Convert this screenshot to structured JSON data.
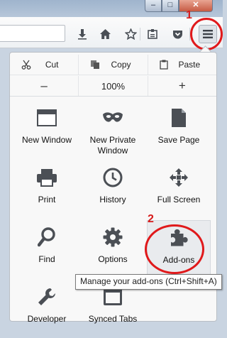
{
  "window_controls": {
    "minimize": "–",
    "maximize": "□",
    "close": "✕"
  },
  "toolbar": {
    "icons": [
      "download-icon",
      "home-icon",
      "bookmark-star-icon",
      "reading-list-icon",
      "pocket-icon",
      "hamburger-menu-icon"
    ]
  },
  "annotations": {
    "step1": "1",
    "step2": "2",
    "ring_color": "#e0191b"
  },
  "menu": {
    "edit": {
      "cut": "Cut",
      "copy": "Copy",
      "paste": "Paste"
    },
    "zoom": {
      "out": "–",
      "level": "100%",
      "in": "+"
    },
    "items": [
      {
        "label": "New Window",
        "icon": "new-window-icon"
      },
      {
        "label": "New Private\nWindow",
        "icon": "private-mask-icon"
      },
      {
        "label": "Save Page",
        "icon": "save-page-icon"
      },
      {
        "label": "Print",
        "icon": "printer-icon"
      },
      {
        "label": "History",
        "icon": "clock-icon"
      },
      {
        "label": "Full Screen",
        "icon": "full-screen-icon"
      },
      {
        "label": "Find",
        "icon": "magnifier-icon"
      },
      {
        "label": "Options",
        "icon": "gear-icon"
      },
      {
        "label": "Add-ons",
        "icon": "puzzle-piece-icon"
      },
      {
        "label": "Developer",
        "icon": "wrench-icon"
      },
      {
        "label": "Synced Tabs",
        "icon": "synced-tabs-icon"
      }
    ]
  },
  "tooltip": {
    "text": "Manage your add-ons (Ctrl+Shift+A)"
  }
}
